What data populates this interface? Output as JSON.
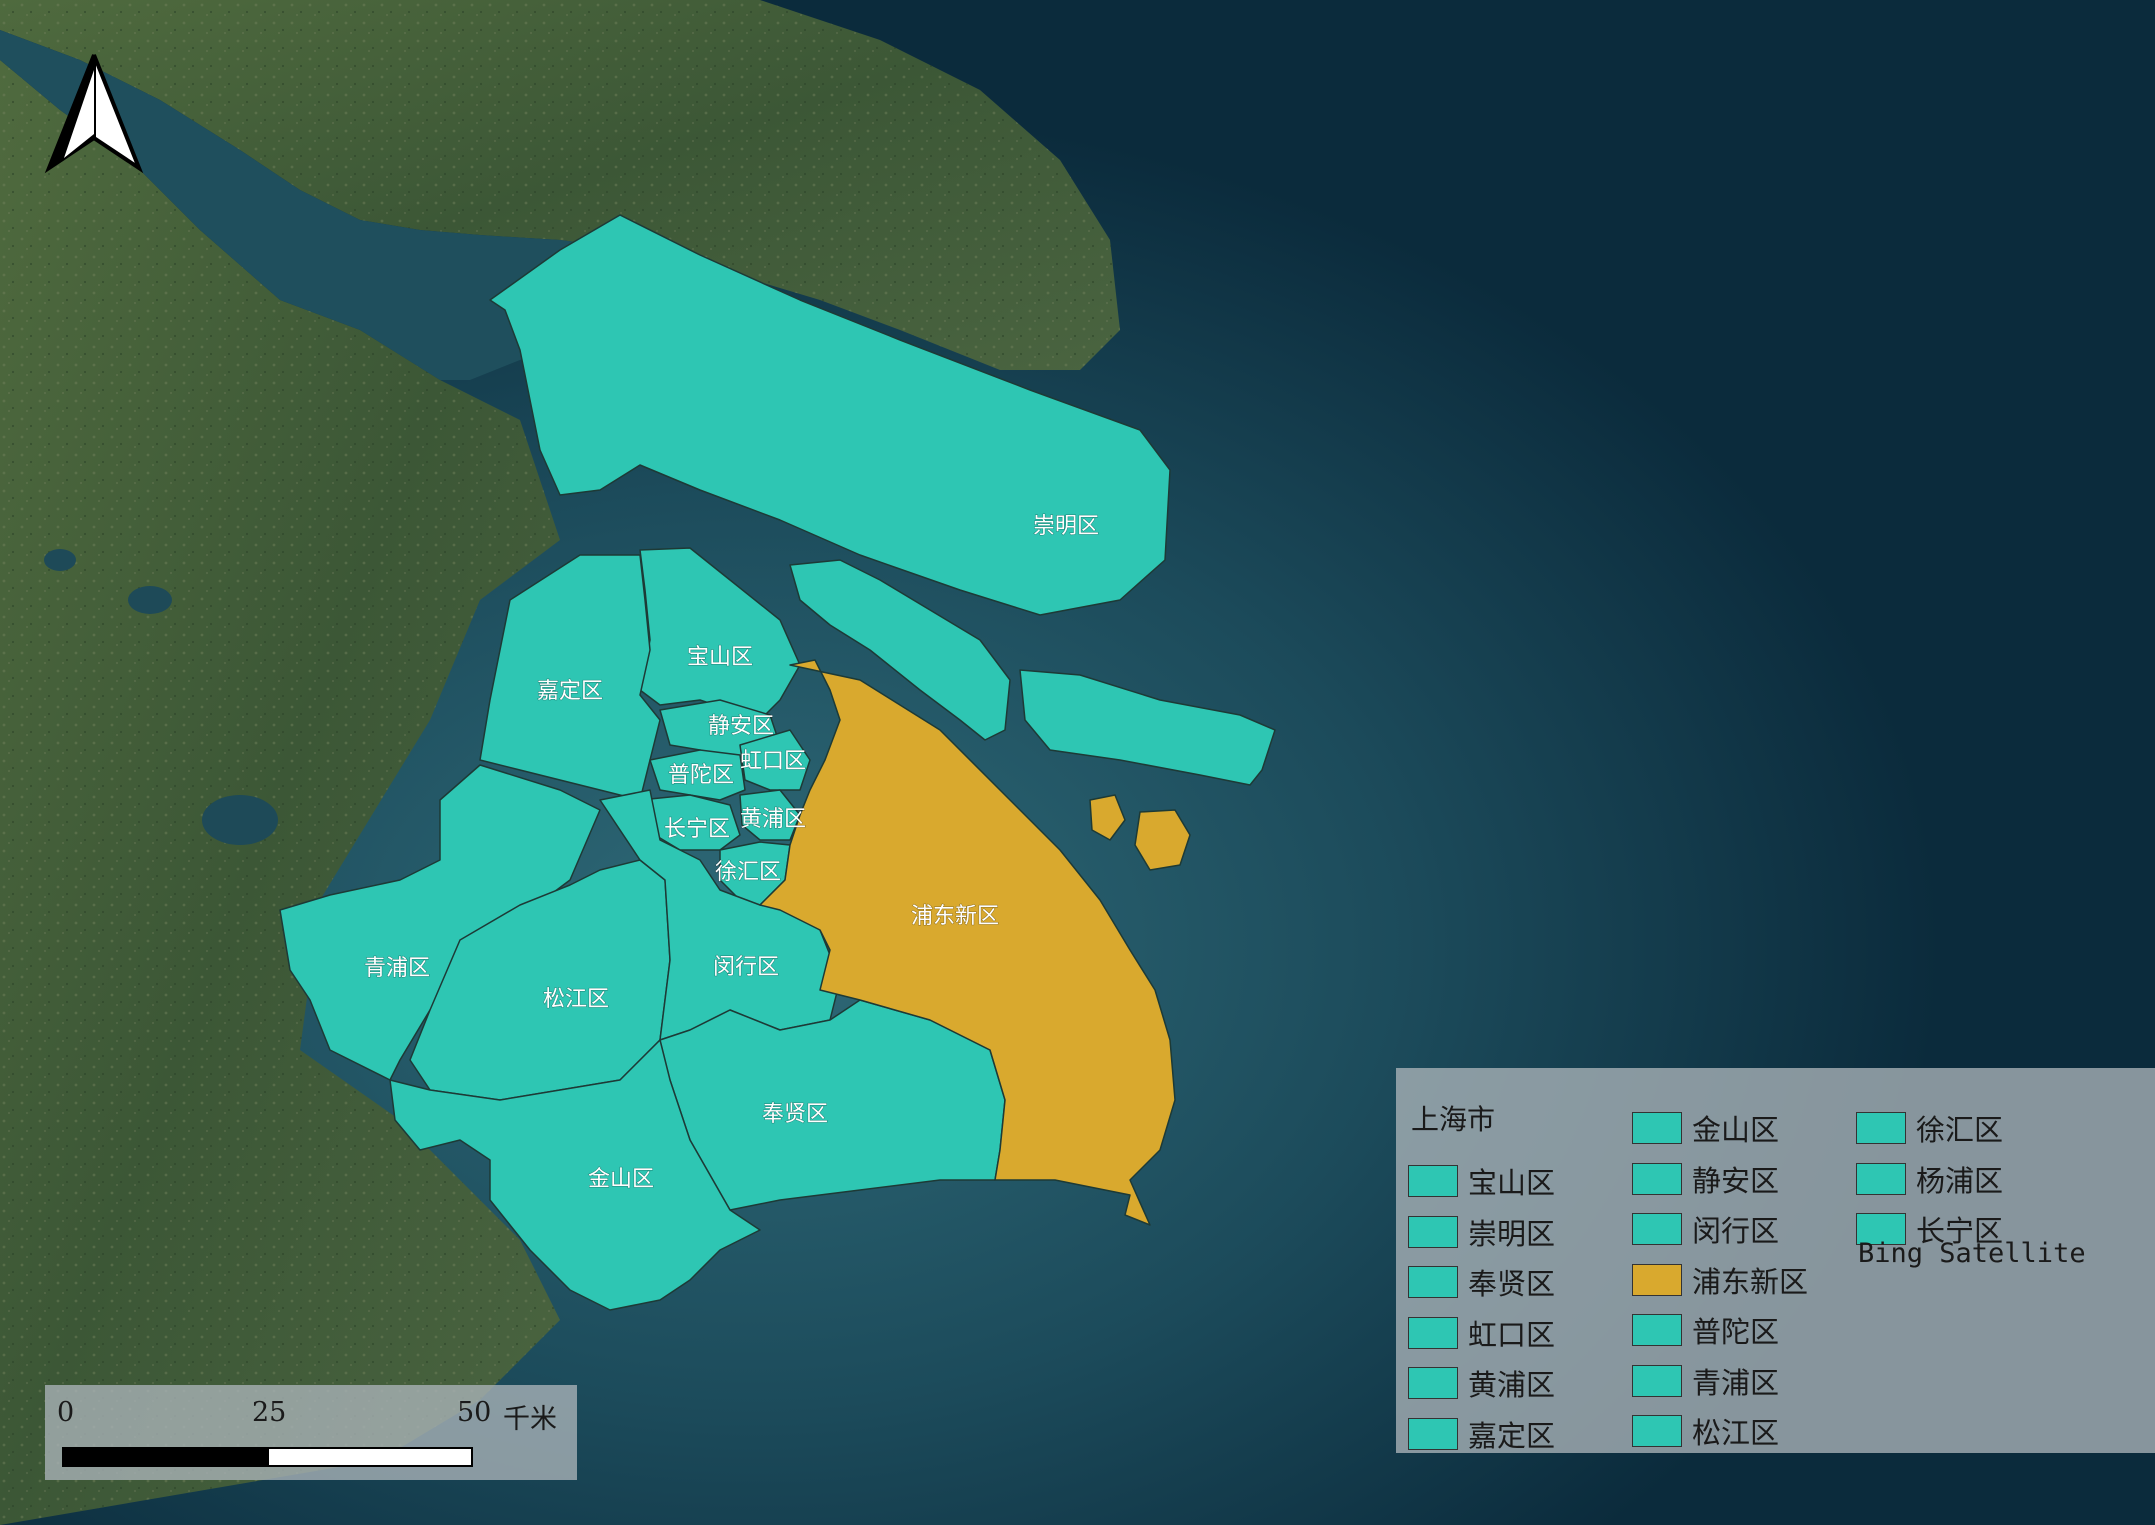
{
  "colors": {
    "district_fill": "#2ec6b3",
    "highlight_fill": "#d9a92e",
    "boundary": "#1d3a36",
    "sea": "#0b2b3c",
    "land": "#3e5a35"
  },
  "districts": [
    {
      "key": "chongming",
      "label": "崇明区",
      "highlight": false
    },
    {
      "key": "baoshan",
      "label": "宝山区",
      "highlight": false
    },
    {
      "key": "jiading",
      "label": "嘉定区",
      "highlight": false
    },
    {
      "key": "jingan",
      "label": "静安区",
      "highlight": false
    },
    {
      "key": "putuo",
      "label": "普陀区",
      "highlight": false
    },
    {
      "key": "hongkou",
      "label": "虹口区",
      "highlight": false
    },
    {
      "key": "changning",
      "label": "长宁区",
      "highlight": false
    },
    {
      "key": "huangpu",
      "label": "黄浦区",
      "highlight": false
    },
    {
      "key": "xuhui",
      "label": "徐汇区",
      "highlight": false
    },
    {
      "key": "pudong",
      "label": "浦东新区",
      "highlight": true
    },
    {
      "key": "qingpu",
      "label": "青浦区",
      "highlight": false
    },
    {
      "key": "songjiang",
      "label": "松江区",
      "highlight": false
    },
    {
      "key": "minhang",
      "label": "闵行区",
      "highlight": false
    },
    {
      "key": "fengxian",
      "label": "奉贤区",
      "highlight": false
    },
    {
      "key": "jinshan",
      "label": "金山区",
      "highlight": false
    }
  ],
  "legend": {
    "title": "上海市",
    "basemap": "Bing Satellite",
    "columns": [
      [
        {
          "label": "宝山区",
          "highlight": false
        },
        {
          "label": "崇明区",
          "highlight": false
        },
        {
          "label": "奉贤区",
          "highlight": false
        },
        {
          "label": "虹口区",
          "highlight": false
        },
        {
          "label": "黄浦区",
          "highlight": false
        },
        {
          "label": "嘉定区",
          "highlight": false
        }
      ],
      [
        {
          "label": "金山区",
          "highlight": false
        },
        {
          "label": "静安区",
          "highlight": false
        },
        {
          "label": "闵行区",
          "highlight": false
        },
        {
          "label": "浦东新区",
          "highlight": true
        },
        {
          "label": "普陀区",
          "highlight": false
        },
        {
          "label": "青浦区",
          "highlight": false
        },
        {
          "label": "松江区",
          "highlight": false
        }
      ],
      [
        {
          "label": "徐汇区",
          "highlight": false
        },
        {
          "label": "杨浦区",
          "highlight": false
        },
        {
          "label": "长宁区",
          "highlight": false
        }
      ]
    ]
  },
  "scalebar": {
    "ticks": [
      "0",
      "25",
      "50"
    ],
    "unit": "千米"
  },
  "icons": {
    "north_arrow": "north-arrow-icon"
  }
}
